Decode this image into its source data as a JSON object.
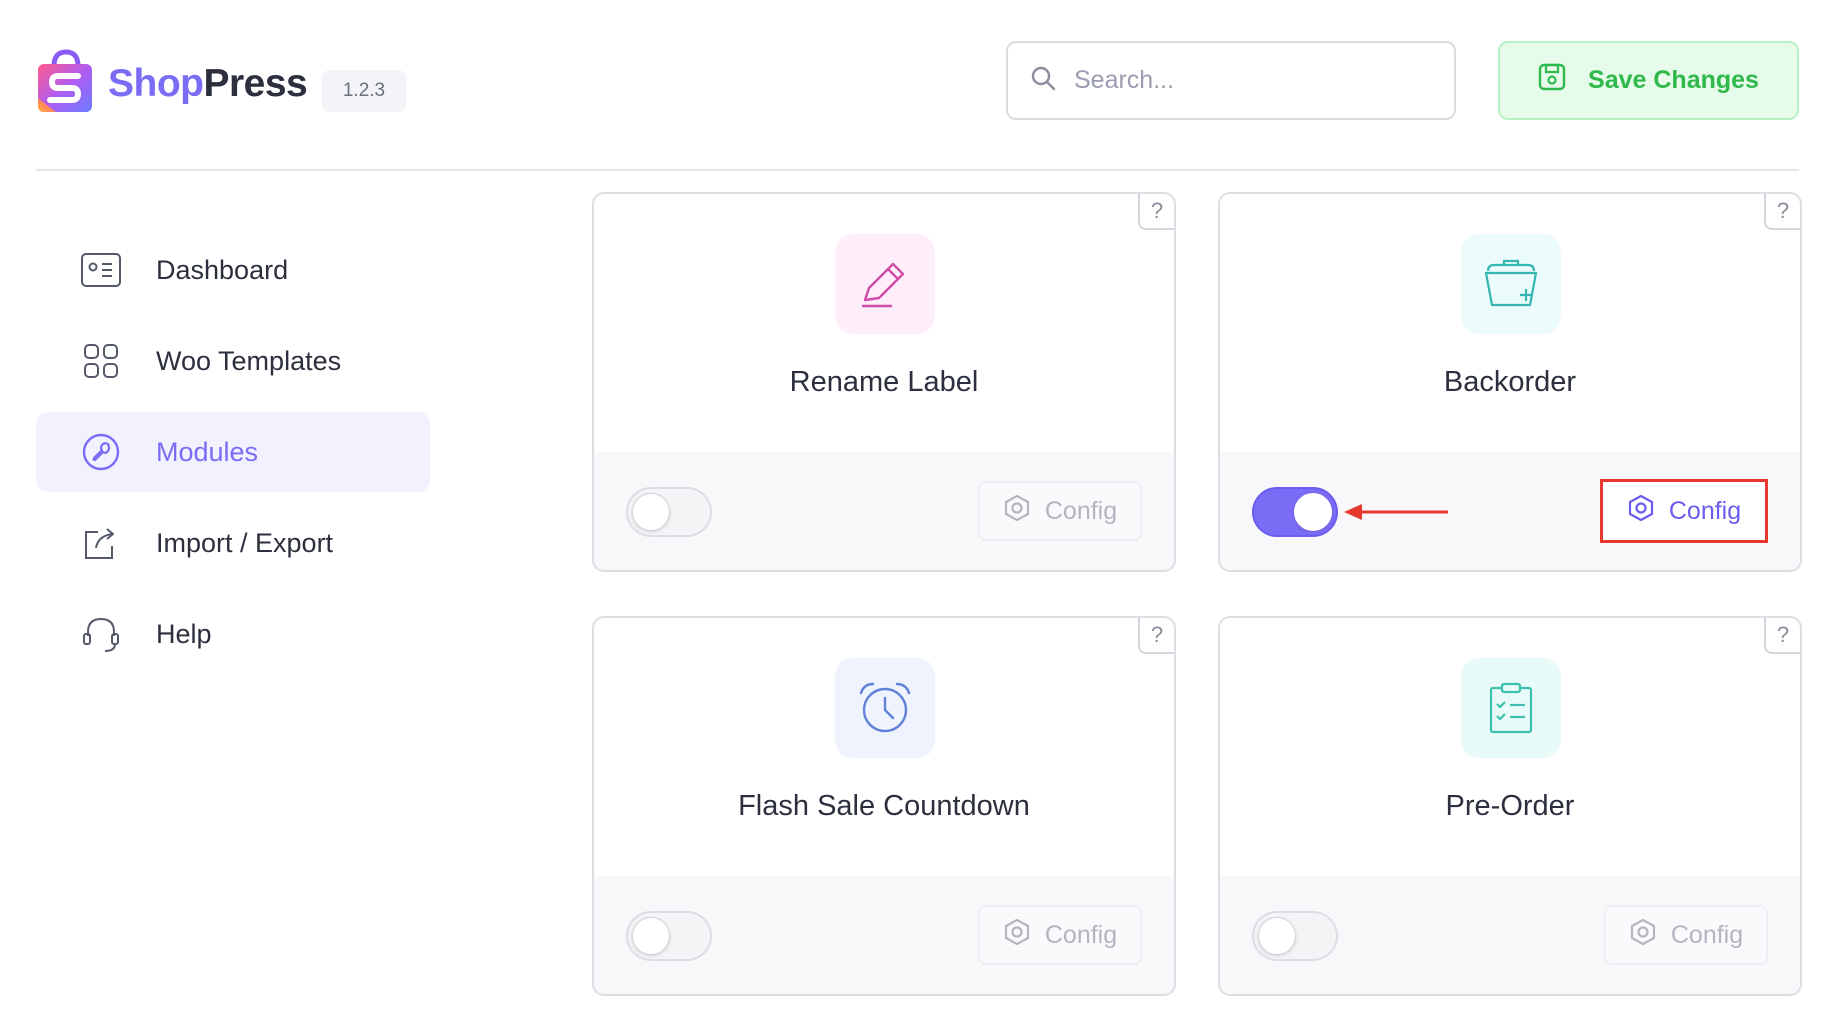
{
  "header": {
    "brand_part1": "Shop",
    "brand_part2": "Press",
    "version": "1.2.3",
    "search_placeholder": "Search...",
    "save_label": "Save Changes"
  },
  "sidebar": {
    "items": [
      {
        "label": "Dashboard",
        "icon": "dashboard-icon",
        "active": false
      },
      {
        "label": "Woo Templates",
        "icon": "grid-icon",
        "active": false
      },
      {
        "label": "Modules",
        "icon": "wrench-icon",
        "active": true
      },
      {
        "label": "Import / Export",
        "icon": "share-icon",
        "active": false
      },
      {
        "label": "Help",
        "icon": "headset-icon",
        "active": false
      }
    ]
  },
  "modules": [
    {
      "title": "Rename Label",
      "icon": "pencil-icon",
      "enabled": false,
      "config_label": "Config",
      "help": "?"
    },
    {
      "title": "Backorder",
      "icon": "basket-icon",
      "enabled": true,
      "config_label": "Config",
      "help": "?"
    },
    {
      "title": "Flash Sale Countdown",
      "icon": "alarm-clock-icon",
      "enabled": false,
      "config_label": "Config",
      "help": "?"
    },
    {
      "title": "Pre-Order",
      "icon": "clipboard-icon",
      "enabled": false,
      "config_label": "Config",
      "help": "?"
    }
  ],
  "colors": {
    "accent": "#7b6cf6",
    "save_green": "#2fb84b",
    "highlight_red": "#e63a30"
  }
}
